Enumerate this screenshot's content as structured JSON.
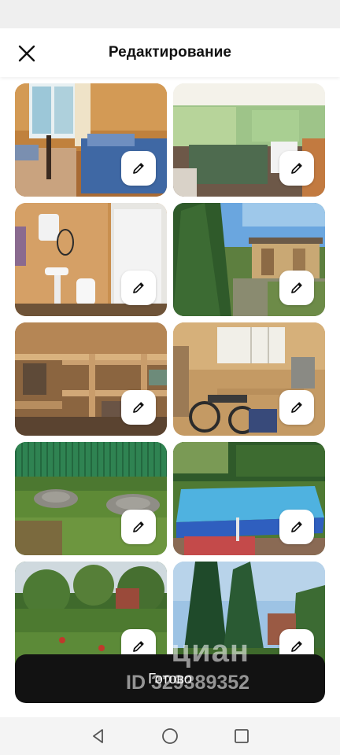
{
  "header": {
    "title": "Редактирование",
    "close_icon": "close-icon"
  },
  "photos": [
    {
      "scene": "bedroom",
      "edit_icon": "pencil-icon"
    },
    {
      "scene": "kitchen-veranda",
      "edit_icon": "pencil-icon"
    },
    {
      "scene": "bathroom",
      "edit_icon": "pencil-icon"
    },
    {
      "scene": "garden-shed",
      "edit_icon": "pencil-icon"
    },
    {
      "scene": "workshop-shelves",
      "edit_icon": "pencil-icon"
    },
    {
      "scene": "workshop-bicycles",
      "edit_icon": "pencil-icon"
    },
    {
      "scene": "lawn-manholes",
      "edit_icon": "pencil-icon"
    },
    {
      "scene": "pool",
      "edit_icon": "pencil-icon"
    },
    {
      "scene": "garden-trees",
      "edit_icon": "pencil-icon"
    },
    {
      "scene": "spruce-trees",
      "edit_icon": "pencil-icon"
    }
  ],
  "actions": {
    "done_label": "Готово"
  },
  "watermark": {
    "brand": "циан",
    "id_text": "ID 329389352"
  },
  "system_nav": {
    "back_icon": "back-triangle-icon",
    "home_icon": "home-circle-icon",
    "recents_icon": "recents-square-icon"
  },
  "colors": {
    "button_bg": "#121212",
    "edit_button_bg": "#ffffff",
    "nav_bar_bg": "#f4f4f4"
  }
}
